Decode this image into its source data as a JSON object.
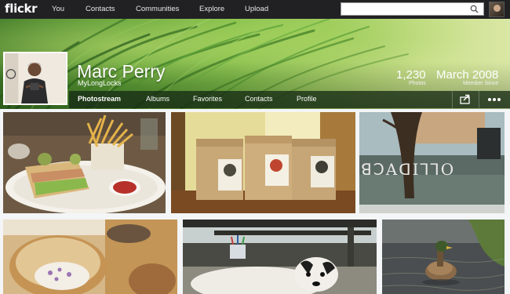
{
  "app": {
    "logo": "flickr"
  },
  "topnav": {
    "links": [
      "You",
      "Contacts",
      "Communities",
      "Explore",
      "Upload"
    ],
    "search": {
      "value": "",
      "placeholder": ""
    }
  },
  "profile": {
    "name": "Marc Perry",
    "username": "MyLongLocks",
    "stats": [
      {
        "value": "1,230",
        "label": "Photos"
      },
      {
        "value": "March 2008",
        "label": "Member Since"
      }
    ]
  },
  "subnav": {
    "items": [
      "Photostream",
      "Albums",
      "Favorites",
      "Contacts",
      "Profile"
    ],
    "active": "Photostream"
  },
  "photos": [
    {
      "subject": "sandwich and fries plate"
    },
    {
      "subject": "coffee bags on table"
    },
    {
      "subject": "street window lettering"
    },
    {
      "subject": "woven basket"
    },
    {
      "subject": "dog under table"
    },
    {
      "subject": "duck on water"
    }
  ],
  "colors": {
    "topnav": "#212124",
    "cover_green": "#6aa83c",
    "subnav": "#1e3a1a"
  }
}
